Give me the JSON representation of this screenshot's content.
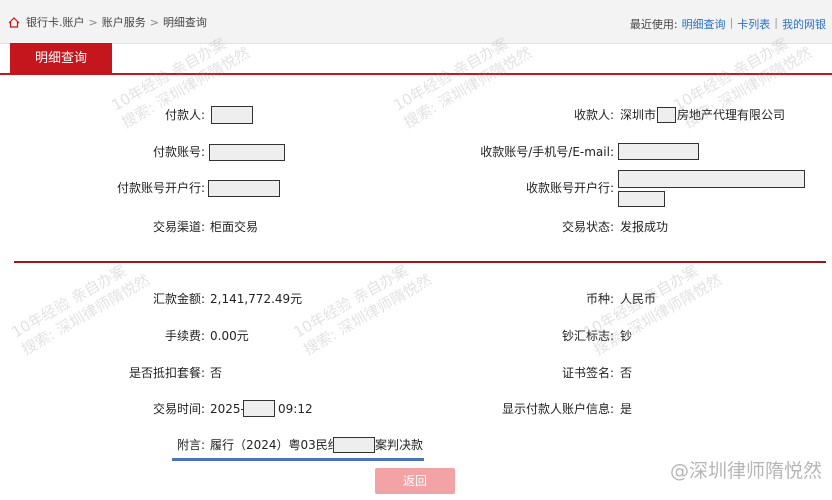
{
  "breadcrumb": {
    "items": [
      "银行卡.账户",
      "账户服务",
      "明细查询"
    ],
    "separator": ">"
  },
  "recent": {
    "label": "最近使用:",
    "links": [
      "明细查询",
      "卡列表",
      "我的网银"
    ]
  },
  "tab": {
    "title": "明细查询"
  },
  "payer": {
    "name_label": "付款人:",
    "account_label": "付款账号:",
    "bank_label": "付款账号开户行:"
  },
  "payee": {
    "name_label": "收款人:",
    "name_value_prefix": "深圳市",
    "name_value_suffix": "房地产代理有限公司",
    "account_label": "收款账号/手机号/E-mail:",
    "bank_label": "收款账号开户行:"
  },
  "channel": {
    "label": "交易渠道:",
    "value": "柜面交易"
  },
  "status": {
    "label": "交易状态:",
    "value": "发报成功"
  },
  "amount": {
    "label": "汇款金额:",
    "value": "2,141,772.49元"
  },
  "currency": {
    "label": "币种:",
    "value": "人民币"
  },
  "fee": {
    "label": "手续费:",
    "value": "0.00元"
  },
  "cash_flag": {
    "label": "钞汇标志:",
    "value": "钞"
  },
  "package": {
    "label": "是否抵扣套餐:",
    "value": "否"
  },
  "cert_sign": {
    "label": "证书签名:",
    "value": "否"
  },
  "time": {
    "label": "交易时间:",
    "value_prefix": "2025-",
    "value_suffix": "09:12"
  },
  "show_payer": {
    "label": "显示付款人账户信息:",
    "value": "是"
  },
  "note": {
    "label": "附言:",
    "value_prefix": "履行（2024）粤03民终",
    "value_suffix": "案判决款"
  },
  "actions": {
    "back_label": "返回"
  },
  "watermarks": {
    "line1": "10年经验 亲自办案",
    "line2": "搜索: 深圳律师隋悦然",
    "brand": "@深圳律师隋悦然"
  },
  "colors": {
    "accent": "#c4161c",
    "link": "#2a6fc9",
    "underline": "#4a74b8"
  }
}
